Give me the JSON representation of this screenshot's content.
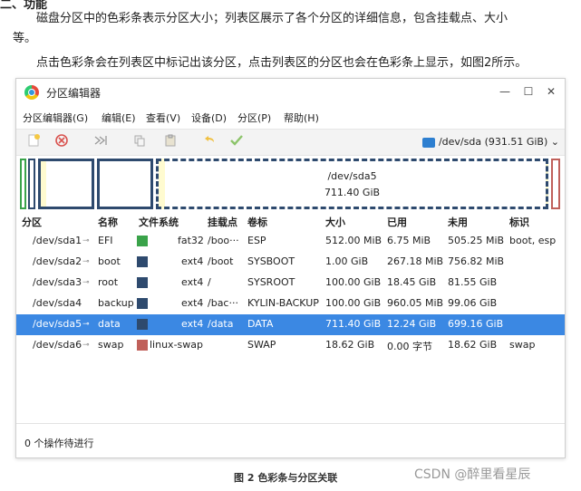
{
  "doc": {
    "heading_partial": "二、功能",
    "para1": "磁盘分区中的色彩条表示分区大小；列表区展示了各个分区的详细信息，包含挂载点、大小",
    "para1_cont": "等。",
    "para2": "点击色彩条会在列表区中标记出该分区，点击列表区的分区也会在色彩条上显示，如图2所示。",
    "caption": "图 2 色彩条与分区关联",
    "watermark": "CSDN @醉里看星辰"
  },
  "window": {
    "title": "分区编辑器",
    "controls": {
      "minimize": "—",
      "maximize": "☐",
      "close": "✕"
    }
  },
  "menu": [
    "分区编辑器(G)",
    "编辑(E)",
    "查看(V)",
    "设备(D)",
    "分区(P)",
    "帮助(H)"
  ],
  "toolbar": {
    "icons": [
      "new-partition-icon",
      "delete-icon",
      "resize-icon",
      "copy-icon",
      "paste-icon",
      "undo-icon",
      "apply-icon"
    ],
    "device": "/dev/sda (931.51 GiB)",
    "device_icon": "hard-disk-icon"
  },
  "partition_bar": {
    "selected_name": "/dev/sda5",
    "selected_size": "711.40 GiB"
  },
  "table": {
    "headers": [
      "分区",
      "名称",
      "文件系统",
      "挂载点",
      "卷标",
      "大小",
      "已用",
      "未用",
      "标识"
    ],
    "rows": [
      {
        "partition": "/dev/sda1",
        "name": "EFI",
        "color": "#3aa34a",
        "fs": "fat32",
        "mount": "/boo···",
        "label": "ESP",
        "size": "512.00 MiB",
        "used": "6.75 MiB",
        "unused": "505.25 MiB",
        "flags": "boot, esp"
      },
      {
        "partition": "/dev/sda2",
        "name": "boot",
        "color": "#2e4a6e",
        "fs": "ext4",
        "mount": "/boot",
        "label": "SYSBOOT",
        "size": "1.00 GiB",
        "used": "267.18 MiB",
        "unused": "756.82 MiB",
        "flags": ""
      },
      {
        "partition": "/dev/sda3",
        "name": "root",
        "color": "#2e4a6e",
        "fs": "ext4",
        "mount": "/",
        "label": "SYSROOT",
        "size": "100.00 GiB",
        "used": "18.45 GiB",
        "unused": "81.55 GiB",
        "flags": ""
      },
      {
        "partition": "/dev/sda4",
        "name": "backup",
        "color": "#2e4a6e",
        "fs": "ext4",
        "mount": "/bac···",
        "label": "KYLIN-BACKUP",
        "size": "100.00 GiB",
        "used": "960.05 MiB",
        "unused": "99.06 GiB",
        "flags": ""
      },
      {
        "partition": "/dev/sda5",
        "name": "data",
        "color": "#2e4a6e",
        "fs": "ext4",
        "mount": "/data",
        "label": "DATA",
        "size": "711.40 GiB",
        "used": "12.24 GiB",
        "unused": "699.16 GiB",
        "flags": ""
      },
      {
        "partition": "/dev/sda6",
        "name": "swap",
        "color": "#c0605a",
        "fs": "linux-swap",
        "mount": "",
        "label": "SWAP",
        "size": "18.62 GiB",
        "used": "0.00 字节",
        "unused": "18.62 GiB",
        "flags": "swap"
      }
    ]
  },
  "status": "0 个操作待进行"
}
